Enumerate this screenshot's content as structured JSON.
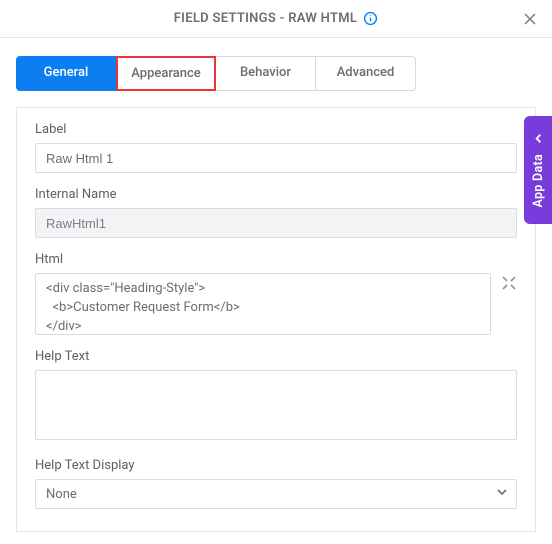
{
  "header": {
    "title": "FIELD SETTINGS - RAW HTML"
  },
  "tabs": {
    "general": "General",
    "appearance": "Appearance",
    "behavior": "Behavior",
    "advanced": "Advanced"
  },
  "fields": {
    "label": {
      "title": "Label",
      "value": "Raw Html 1"
    },
    "internal_name": {
      "title": "Internal Name",
      "value": "RawHtml1"
    },
    "html": {
      "title": "Html",
      "value": "<div class=\"Heading-Style\">\n  <b>Customer Request Form</b>\n</div>"
    },
    "help_text": {
      "title": "Help Text",
      "value": ""
    },
    "help_text_display": {
      "title": "Help Text Display",
      "value": "None"
    }
  },
  "side": {
    "label": "App Data"
  }
}
